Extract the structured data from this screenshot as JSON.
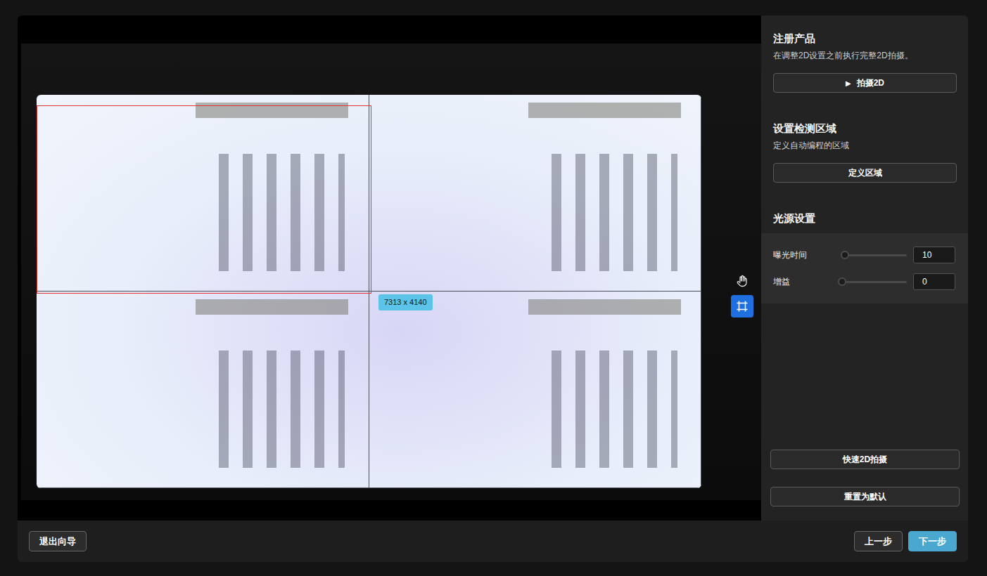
{
  "canvas": {
    "selection_size": "7313 x 4140",
    "tools": [
      {
        "kind": "pan",
        "selected": false
      },
      {
        "kind": "region",
        "selected": true
      }
    ]
  },
  "register": {
    "title": "注册产品",
    "description": "在调整2D设置之前执行完整2D拍摄。",
    "button": {
      "icon": "▶",
      "label": "拍摄2D"
    }
  },
  "region": {
    "title": "设置检测区域",
    "description": "定义自动编程的区域",
    "button": "定义区域"
  },
  "light": {
    "title": "光源设置",
    "sliders": [
      {
        "label": "曝光时间",
        "value": "10",
        "level": 0.04
      },
      {
        "label": "增益",
        "value": "0",
        "level": 0.0
      }
    ]
  },
  "actions": [
    "快速2D拍摄",
    "重置为默认"
  ],
  "footer": {
    "exit": "退出向导",
    "prev": "上一步",
    "next": "下一步"
  }
}
